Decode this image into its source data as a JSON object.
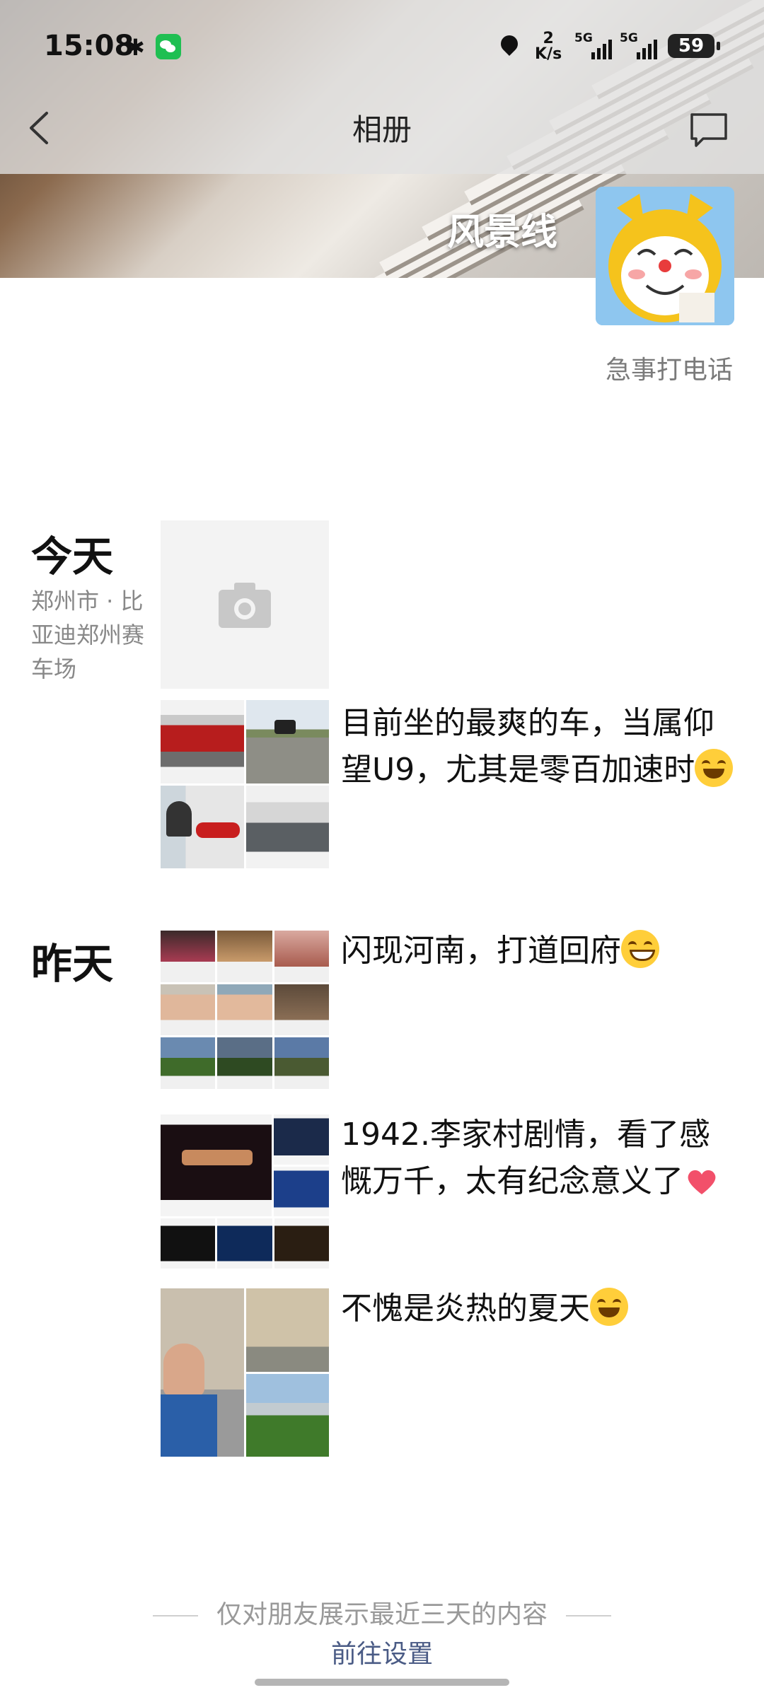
{
  "status_bar": {
    "time": "15:08",
    "net_speed_value": "2",
    "net_speed_unit": "K/s",
    "sim1_label": "5G",
    "sim2_label": "5G",
    "battery": "59"
  },
  "nav": {
    "title": "相册"
  },
  "profile": {
    "username": "风景线",
    "signature": "急事打电话"
  },
  "days": [
    {
      "label": "今天",
      "location": "郑州市 · 比亚迪郑州赛车场",
      "posts": [
        {
          "type": "photo-placeholder"
        },
        {
          "text": "目前坐的最爽的车，当属仰望U9，尤其是零百加速时",
          "emoji": "laughing-tears"
        }
      ]
    },
    {
      "label": "昨天",
      "posts": [
        {
          "text": "闪现河南，打道回府",
          "emoji": "grin"
        },
        {
          "text": "1942.李家村剧情，看了感慨万千，太有纪念意义了",
          "emoji": "heart"
        },
        {
          "text": "不愧是炎热的夏天",
          "emoji": "laughing-tears"
        }
      ]
    }
  ],
  "footer": {
    "notice": "仅对朋友展示最近三天的内容",
    "link": "前往设置"
  },
  "colors": {
    "accent_link": "#4a5b85",
    "secondary_text": "#888888",
    "placeholder_bg": "#f3f3f3"
  }
}
